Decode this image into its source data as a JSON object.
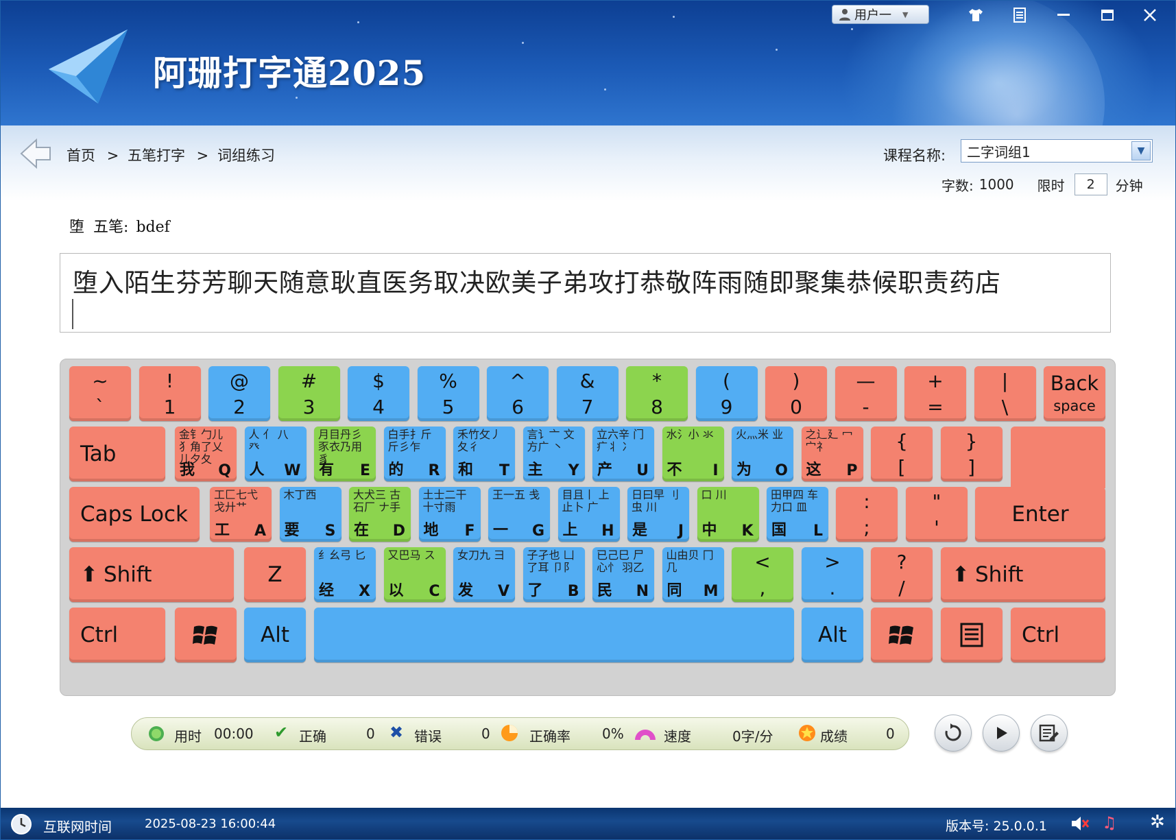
{
  "window": {
    "title": "阿珊打字通2025",
    "user_label": "用户一",
    "icons": [
      "skin-icon",
      "menu-icon",
      "minimize-icon",
      "maximize-icon",
      "close-icon"
    ]
  },
  "breadcrumb": {
    "home": "首页",
    "section": "五笔打字",
    "page": "词组练习",
    "separator": ">"
  },
  "course": {
    "label": "课程名称:",
    "value": "二字词组1",
    "count_label": "字数:",
    "count_value": "1000",
    "limit_label": "限时",
    "limit_value": "2",
    "limit_unit": "分钟"
  },
  "hint": {
    "char": "堕",
    "label": "五笔:",
    "code": "bdef"
  },
  "practice": {
    "text": "堕入陌生芬芳聊天随意耿直医务取决欧美子弟攻打恭敬阵雨随即聚集恭候职责药店"
  },
  "keyboard": {
    "row1": [
      {
        "top": "~",
        "bottom": "`"
      },
      {
        "top": "!",
        "bottom": "1"
      },
      {
        "top": "@",
        "bottom": "2"
      },
      {
        "top": "#",
        "bottom": "3"
      },
      {
        "top": "$",
        "bottom": "4"
      },
      {
        "top": "%",
        "bottom": "5"
      },
      {
        "top": "^",
        "bottom": "6"
      },
      {
        "top": "&",
        "bottom": "7"
      },
      {
        "top": "*",
        "bottom": "8"
      },
      {
        "top": "(",
        "bottom": "9"
      },
      {
        "top": ")",
        "bottom": "0"
      },
      {
        "top": "—",
        "bottom": "-"
      },
      {
        "top": "+",
        "bottom": "="
      },
      {
        "top": "|",
        "bottom": "\\"
      }
    ],
    "backspace": {
      "line1": "Back",
      "line2": "space"
    },
    "tab": "Tab",
    "row2": [
      {
        "letter": "Q",
        "word": "我",
        "roots": "金钅勹儿 犭角了乂 儿夕夂"
      },
      {
        "letter": "W",
        "word": "人",
        "roots": "人 亻 八 癶"
      },
      {
        "letter": "E",
        "word": "有",
        "roots": "月目丹彡 豕衣乃用 豸"
      },
      {
        "letter": "R",
        "word": "的",
        "roots": "白手扌斤 斤彡乍"
      },
      {
        "letter": "T",
        "word": "和",
        "roots": "禾竹攵丿 夂彳"
      },
      {
        "letter": "Y",
        "word": "主",
        "roots": "言讠亠 文方广 丶"
      },
      {
        "letter": "U",
        "word": "产",
        "roots": "立六辛 门疒丬 冫"
      },
      {
        "letter": "I",
        "word": "不",
        "roots": "水氵小 氺"
      },
      {
        "letter": "O",
        "word": "为",
        "roots": "火灬米 业"
      },
      {
        "letter": "P",
        "word": "这",
        "roots": "之辶廴 冖宀礻"
      }
    ],
    "brackets": [
      {
        "top": "{",
        "bottom": "["
      },
      {
        "top": "}",
        "bottom": "]"
      }
    ],
    "enter": "Enter",
    "caps": "Caps Lock",
    "row3": [
      {
        "letter": "A",
        "word": "工",
        "roots": "工匚七弋 戈廾艹"
      },
      {
        "letter": "S",
        "word": "要",
        "roots": "木丁西"
      },
      {
        "letter": "D",
        "word": "在",
        "roots": "大犬三 古石厂 ナ手"
      },
      {
        "letter": "F",
        "word": "地",
        "roots": "土士二干 十寸雨"
      },
      {
        "letter": "G",
        "word": "一",
        "roots": "王一五 戋"
      },
      {
        "letter": "H",
        "word": "上",
        "roots": "目且丨 上止卜 广"
      },
      {
        "letter": "J",
        "word": "是",
        "roots": "日曰早 刂虫 川"
      },
      {
        "letter": "K",
        "word": "中",
        "roots": "口 川"
      },
      {
        "letter": "L",
        "word": "国",
        "roots": "田甲四 车力口 皿"
      }
    ],
    "semicolon": {
      "top": ":",
      "bottom": ";"
    },
    "quote": {
      "top": "\"",
      "bottom": "'"
    },
    "shift": "Shift",
    "row4": [
      {
        "letter": "X",
        "word": "经",
        "roots": "纟幺弓 匕"
      },
      {
        "letter": "C",
        "word": "以",
        "roots": "又巴马 ス"
      },
      {
        "letter": "V",
        "word": "发",
        "roots": "女刀九 彐"
      },
      {
        "letter": "B",
        "word": "了",
        "roots": "子孑也 凵了耳 卩阝"
      },
      {
        "letter": "N",
        "word": "民",
        "roots": "已己巳 尸心忄 羽乙"
      },
      {
        "letter": "M",
        "word": "同",
        "roots": "山由贝 冂几"
      }
    ],
    "z_key": "Z",
    "comma": {
      "top": "<",
      "bottom": ","
    },
    "period": {
      "top": ">",
      "bottom": "."
    },
    "slash": {
      "top": "?",
      "bottom": "/"
    },
    "ctrl": "Ctrl",
    "alt": "Alt"
  },
  "stats": {
    "time_label": "用时",
    "time_value": "00:00",
    "correct_label": "正确",
    "correct_value": "0",
    "wrong_label": "错误",
    "wrong_value": "0",
    "accuracy_label": "正确率",
    "accuracy_value": "0%",
    "speed_label": "速度",
    "speed_value": "0字/分",
    "score_label": "成绩",
    "score_value": "0"
  },
  "statusbar": {
    "net_time_label": "互联网时间",
    "datetime": "2025-08-23 16:00:44",
    "version": "版本号: 25.0.0.1"
  },
  "colors": {
    "red_key": "#f4826f",
    "blue_key": "#52adf3",
    "green_key": "#8cd44e",
    "banner": "#1c5bb7"
  }
}
